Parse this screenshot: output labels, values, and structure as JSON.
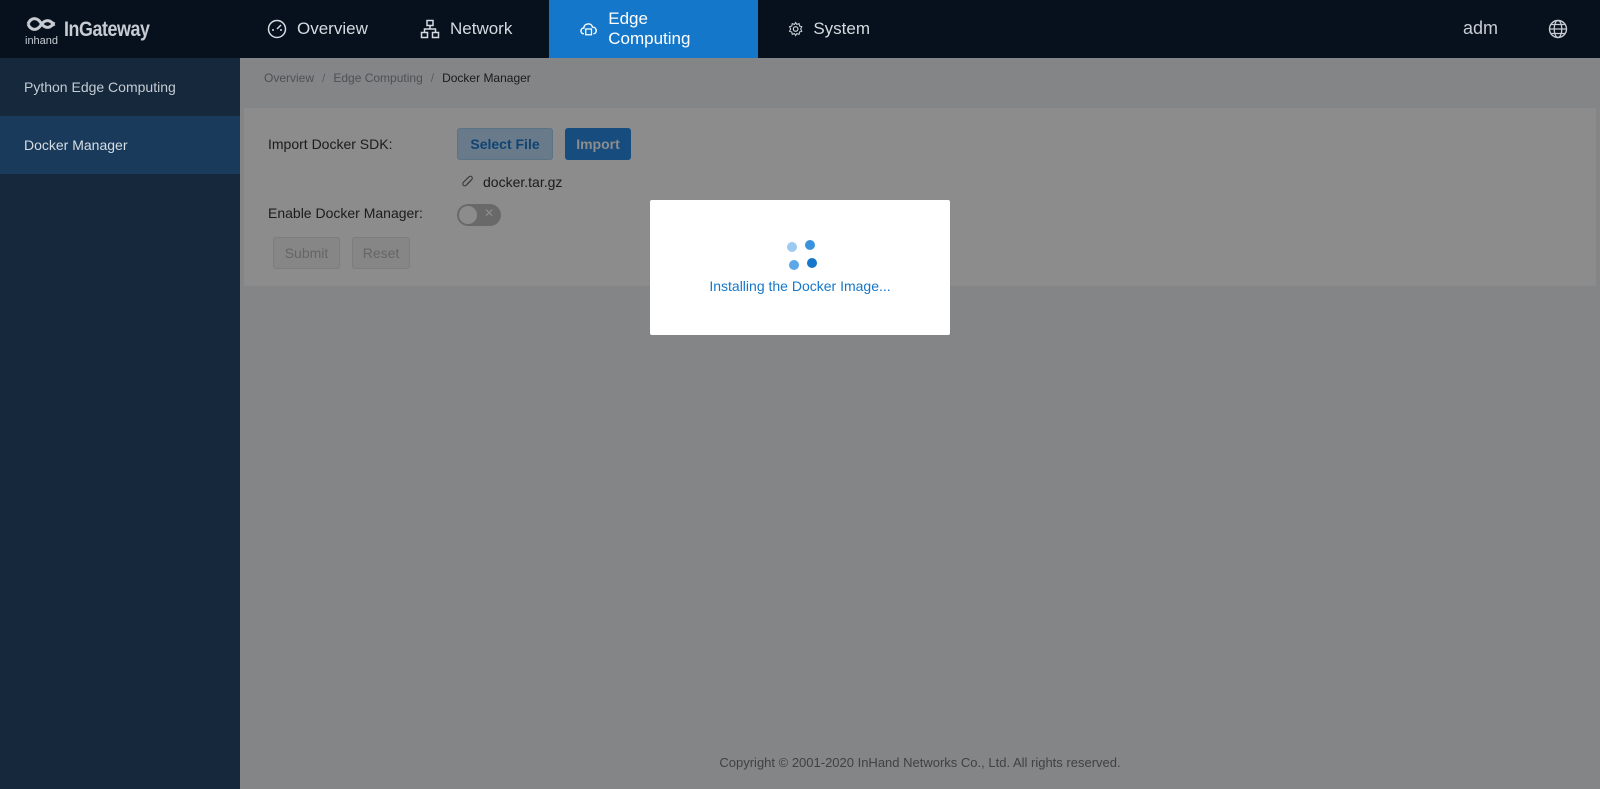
{
  "app": {
    "logo_text": "InGateway",
    "logo_sub": "inhand",
    "user": "adm"
  },
  "nav": [
    {
      "label": "Overview",
      "icon": "dashboard-icon",
      "active": false
    },
    {
      "label": "Network",
      "icon": "network-icon",
      "active": false
    },
    {
      "label": "Edge Computing",
      "icon": "edge-computing-icon",
      "active": true
    },
    {
      "label": "System",
      "icon": "gear-icon",
      "active": false
    }
  ],
  "sidebar": {
    "items": [
      {
        "label": "Python Edge Computing",
        "active": false
      },
      {
        "label": "Docker Manager",
        "active": true
      }
    ]
  },
  "breadcrumb": [
    "Overview",
    "Edge Computing",
    "Docker Manager"
  ],
  "form": {
    "import_label": "Import Docker SDK:",
    "select_file_label": "Select File",
    "import_button": "Import",
    "file_name": "docker.tar.gz",
    "enable_label": "Enable Docker Manager:",
    "enable_value": false,
    "submit_label": "Submit",
    "reset_label": "Reset"
  },
  "footer": "Copyright © 2001-2020 InHand Networks Co., Ltd. All rights reserved.",
  "modal": {
    "message": "Installing the Docker Image..."
  },
  "colors": {
    "accent": "#1477c9",
    "topbar": "#06111d",
    "sidebar": "#16283c"
  }
}
